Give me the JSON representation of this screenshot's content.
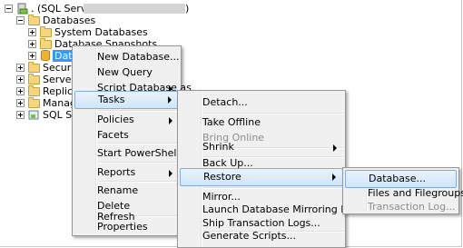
{
  "tree": {
    "server_label": ". (SQL Server",
    "server_label_end": ")",
    "items": [
      {
        "label": "Databases"
      },
      {
        "label": "System Databases"
      },
      {
        "label": "Database Snapshots"
      },
      {
        "label": "Databa"
      },
      {
        "label": "Security"
      },
      {
        "label": "Server Obje"
      },
      {
        "label": "Replication"
      },
      {
        "label": "Manageme"
      },
      {
        "label": "SQL Server"
      }
    ]
  },
  "context_menu": {
    "items": [
      {
        "label": "New Database..."
      },
      {
        "label": "New Query"
      },
      {
        "label": "Script Database as"
      },
      {
        "label": "Tasks"
      },
      {
        "label": "Policies"
      },
      {
        "label": "Facets"
      },
      {
        "label": "Start PowerShell"
      },
      {
        "label": "Reports"
      },
      {
        "label": "Rename"
      },
      {
        "label": "Delete"
      },
      {
        "label": "Refresh"
      },
      {
        "label": "Properties"
      }
    ]
  },
  "tasks_menu": {
    "items": [
      {
        "label": "Detach..."
      },
      {
        "label": "Take Offline"
      },
      {
        "label": "Bring Online"
      },
      {
        "label": "Shrink"
      },
      {
        "label": "Back Up..."
      },
      {
        "label": "Restore"
      },
      {
        "label": "Mirror..."
      },
      {
        "label": "Launch Database Mirroring Monitor..."
      },
      {
        "label": "Ship Transaction Logs..."
      },
      {
        "label": "Generate Scripts..."
      }
    ]
  },
  "restore_menu": {
    "items": [
      {
        "label": "Database..."
      },
      {
        "label": "Files and Filegroups..."
      },
      {
        "label": "Transaction Log..."
      }
    ]
  }
}
